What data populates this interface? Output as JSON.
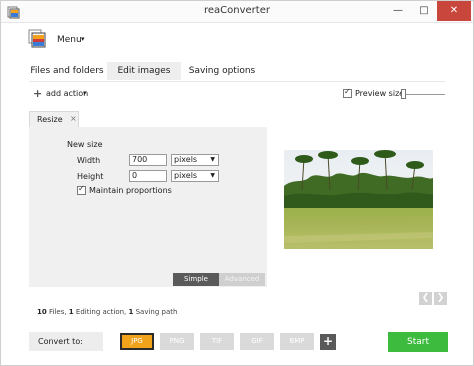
{
  "window": {
    "title": "reaConverter",
    "minimize_glyph": "—",
    "maximize_glyph": "□",
    "close_glyph": "✕"
  },
  "menu": {
    "label": "Menu",
    "caret": "▾"
  },
  "tabs": [
    {
      "label": "Files and folders",
      "active": false
    },
    {
      "label": "Edit images",
      "active": true
    },
    {
      "label": "Saving options",
      "active": false
    }
  ],
  "toolbar": {
    "add_action_icon": "+",
    "add_action_label": "add action",
    "add_action_caret": "▾",
    "preview_label": "Preview size:",
    "preview_checked": true
  },
  "action_tab": {
    "label": "Resize",
    "close": "×"
  },
  "resize": {
    "section_label": "New size",
    "width_label": "Width",
    "width_value": "700",
    "width_unit": "pixels",
    "height_label": "Height",
    "height_value": "0",
    "height_unit": "pixels",
    "select_arrow": "▼",
    "maintain_label": "Maintain proportions",
    "maintain_checked": true
  },
  "mode": {
    "simple": "Simple",
    "advanced": "Advanced"
  },
  "nav": {
    "prev": "❮",
    "next": "❯"
  },
  "summary": {
    "files_count": "10",
    "files_label": " Files, ",
    "actions_count": "1",
    "actions_label": " Editing action, ",
    "paths_count": "1",
    "paths_label": " Saving path"
  },
  "convert": {
    "label": "Convert to:",
    "formats": [
      {
        "label": "JPG",
        "active": true
      },
      {
        "label": "PNG",
        "active": false
      },
      {
        "label": "TIF",
        "active": false
      },
      {
        "label": "GIF",
        "active": false
      },
      {
        "label": "BMP",
        "active": false
      }
    ],
    "add_format": "+",
    "start_label": "Start"
  },
  "colors": {
    "active_format": "#f0a31b",
    "start_button": "#3dbb3f",
    "close_button": "#c9463d"
  },
  "icons": {
    "app": "reaconverter-app-icon",
    "menu_logo": "reaconverter-logo-icon",
    "add_action": "plus-icon",
    "preview_image": "tropical-field-photo"
  }
}
